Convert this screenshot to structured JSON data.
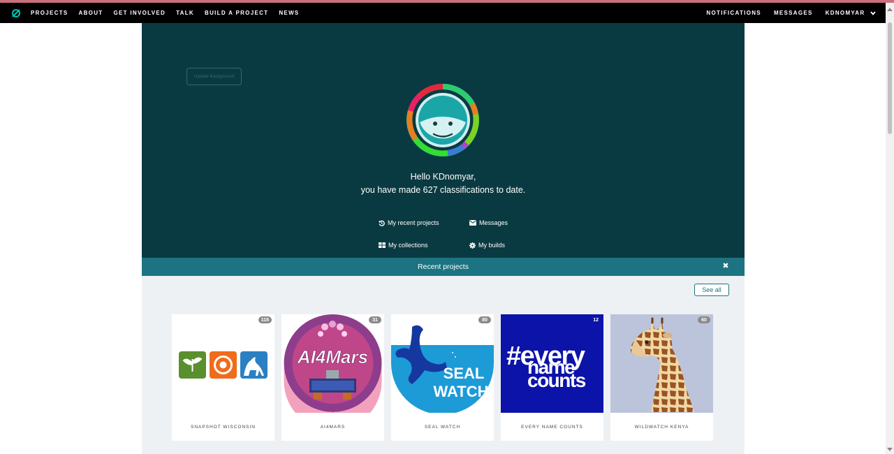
{
  "nav": {
    "logo_icon": "zooniverse-logo-icon",
    "links": [
      "PROJECTS",
      "ABOUT",
      "GET INVOLVED",
      "TALK",
      "BUILD A PROJECT",
      "NEWS"
    ],
    "right": [
      "NOTIFICATIONS",
      "MESSAGES",
      "KDNOMYAR"
    ],
    "user_menu_icon": "chevron-down-icon"
  },
  "hero": {
    "update_background": "Update Background",
    "greeting_line1": "Hello KDnomyar,",
    "greeting_line2": "you have made 627 classifications to date.",
    "links": {
      "recent_projects": "My recent projects",
      "messages": "Messages",
      "collections": "My collections",
      "builds": "My builds"
    }
  },
  "recent": {
    "title": "Recent projects",
    "see_all": "See all",
    "close_icon": "close-icon",
    "projects": [
      {
        "name": "SNAPSHOT WISCONSIN",
        "count": "118"
      },
      {
        "name": "AI4MARS",
        "count": "31"
      },
      {
        "name": "SEAL WATCH",
        "count": "80"
      },
      {
        "name": "EVERY NAME COUNTS",
        "count": "12"
      },
      {
        "name": "WILDWATCH KENYA",
        "count": "60"
      }
    ],
    "thumb_text": {
      "ai4mars": "AI4Mars",
      "seal_line1": "SEAL",
      "seal_line2": "WATCH",
      "enc_line1": "#every",
      "enc_line2": "name",
      "enc_line3": "counts"
    }
  },
  "colors": {
    "nav_bg": "#000000",
    "hero_bg": "#0a3a41",
    "bar_bg": "#1c7381",
    "recent_bg": "#eef1f4"
  }
}
